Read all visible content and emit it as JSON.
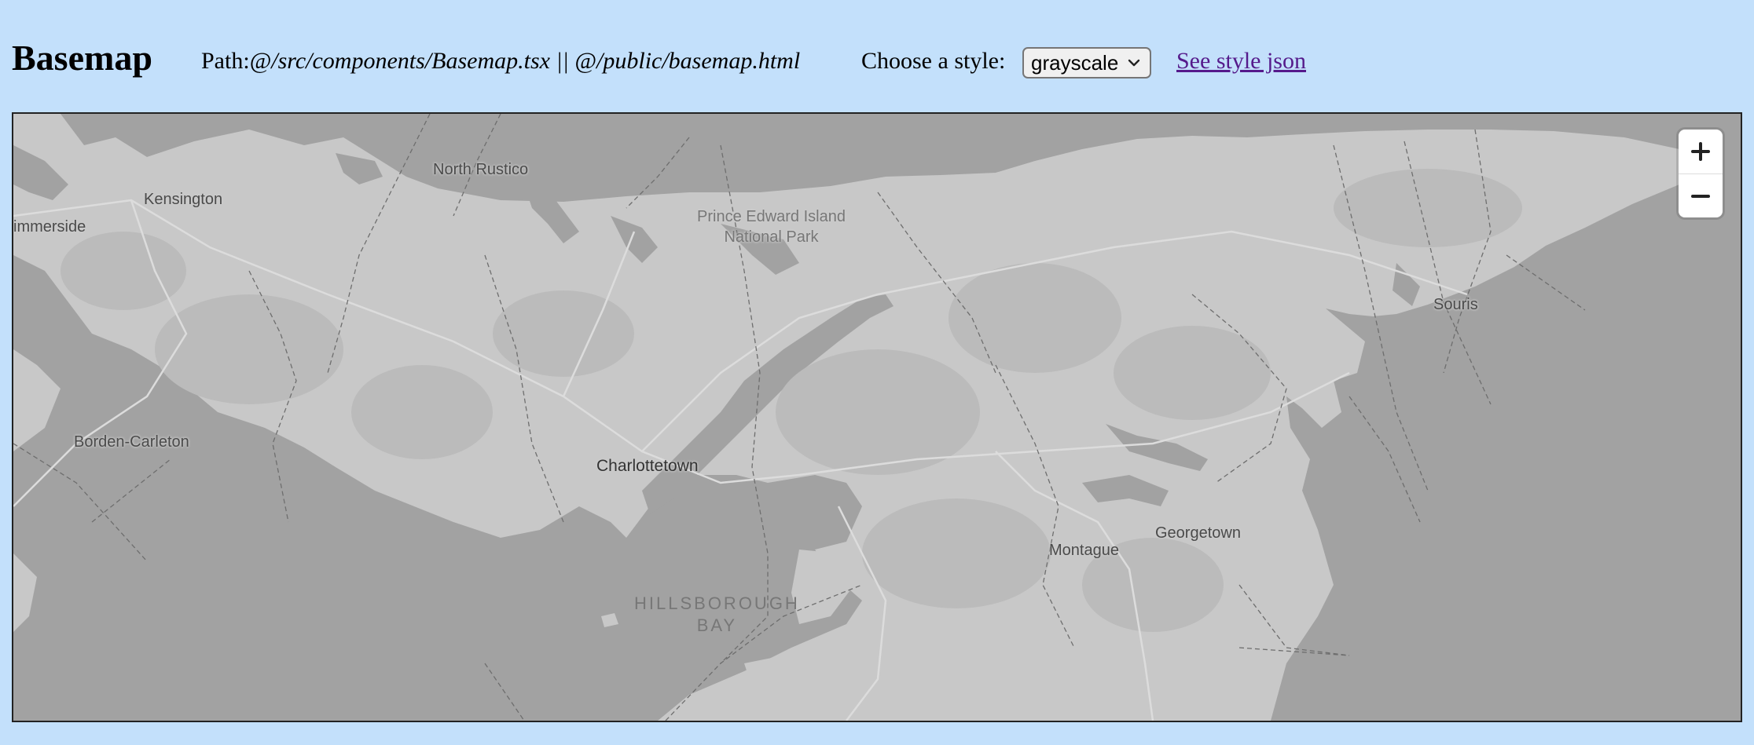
{
  "header": {
    "title": "Basemap",
    "path_prefix": "Path:",
    "path_value": "@/src/components/Basemap.tsx || @/public/basemap.html",
    "style_label": "Choose a style:",
    "style_selected": "grayscale",
    "style_link": "See style json"
  },
  "map": {
    "labels": {
      "north_rustico": "North Rustico",
      "kensington": "Kensington",
      "summerside": "immerside",
      "national_park_1": "Prince Edward Island",
      "national_park_2": "National Park",
      "souris": "Souris",
      "borden_carleton": "Borden-Carleton",
      "charlottetown": "Charlottetown",
      "georgetown": "Georgetown",
      "montague": "Montague",
      "bay_1": "HILLSBOROUGH",
      "bay_2": "BAY"
    },
    "colors": {
      "water": "#a2a2a2",
      "land": "#c8c8c8",
      "forest": "#bbbbbb",
      "roads": "#dddddd",
      "boundaries": "#6e6e6e"
    },
    "zoom_in_icon": "plus-icon",
    "zoom_out_icon": "minus-icon"
  }
}
